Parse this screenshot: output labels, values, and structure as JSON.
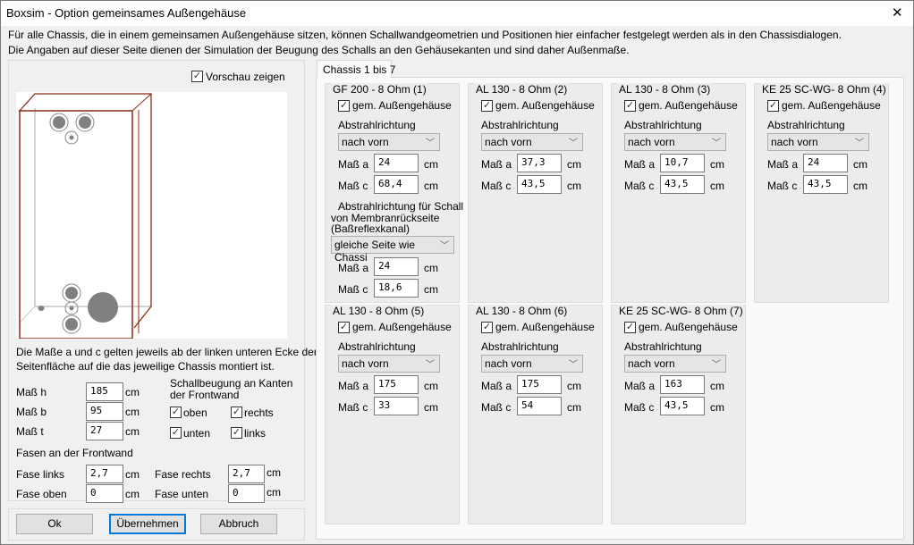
{
  "window": {
    "title": "Boxsim - Option gemeinsames Außengehäuse",
    "close": "✕"
  },
  "info": {
    "line1": "Für alle Chassis, die in einem gemeinsamen Außengehäuse sitzen, können Schallwandgeometrien und Positionen hier einfacher festgelegt werden als in den Chassisdialogen.",
    "line2": "Die Angaben auf dieser Seite dienen der Simulation der  Beugung des Schalls an den Gehäusekanten und sind daher Außenmaße."
  },
  "preview": {
    "label": "Vorschau zeigen",
    "checked": true
  },
  "note": {
    "line1": "Die Maße a und c gelten jeweils ab der linken unteren Ecke der",
    "line2": "Seitenfläche auf die das jeweilige Chassis montiert ist."
  },
  "dims": [
    {
      "label": "Maß h",
      "value": "185",
      "unit": "cm"
    },
    {
      "label": "Maß b",
      "value": "95",
      "unit": "cm"
    },
    {
      "label": "Maß t",
      "value": "27",
      "unit": "cm"
    }
  ],
  "diffraction": {
    "title1": "Schallbeugung an Kanten",
    "title2": "der Frontwand",
    "oben": "oben",
    "rechts": "rechts",
    "unten": "unten",
    "links": "links"
  },
  "bevels": {
    "title": "Fasen an der Frontwand",
    "links": {
      "label": "Fase links",
      "value": "2,7",
      "unit": "cm"
    },
    "rechts": {
      "label": "Fase rechts",
      "value": "2,7",
      "unit": "cm"
    },
    "oben": {
      "label": "Fase oben",
      "value": "0",
      "unit": "cm"
    },
    "unten": {
      "label": "Fase unten",
      "value": "0",
      "unit": "cm"
    }
  },
  "buttons": {
    "ok": "Ok",
    "apply": "Übernehmen",
    "cancel": "Abbruch"
  },
  "tab": {
    "label": "Chassis 1 bis 7"
  },
  "common": {
    "checkbox": "gem. Außengehäuse",
    "direction_label": "Abstrahlrichtung",
    "maß_a": "Maß a",
    "maß_c": "Maß c",
    "unit": "cm"
  },
  "chassis": [
    {
      "title": "GF 200 - 8 Ohm (1)",
      "direction": "nach vorn",
      "a": "24",
      "c": "68,4",
      "rear": {
        "label1": "Abstrahlrichtung für Schall",
        "label2": "von Membranrückseite",
        "label3": "(Baßreflexkanal)",
        "direction": "gleiche Seite wie Chassi",
        "a": "24",
        "c": "18,6"
      }
    },
    {
      "title": "AL 130 - 8 Ohm (2)",
      "direction": "nach vorn",
      "a": "37,3",
      "c": "43,5"
    },
    {
      "title": "AL 130 - 8 Ohm (3)",
      "direction": "nach vorn",
      "a": "10,7",
      "c": "43,5"
    },
    {
      "title": "KE 25 SC-WG- 8 Ohm    (4)",
      "direction": "nach vorn",
      "a": "24",
      "c": "43,5"
    },
    {
      "title": "AL 130 - 8 Ohm (5)",
      "direction": "nach vorn",
      "a": "175",
      "c": "33"
    },
    {
      "title": "AL 130 - 8 Ohm (6)",
      "direction": "nach vorn",
      "a": "175",
      "c": "54"
    },
    {
      "title": "KE 25 SC-WG- 8 Ohm    (7)",
      "direction": "nach vorn",
      "a": "163",
      "c": "43,5"
    }
  ]
}
